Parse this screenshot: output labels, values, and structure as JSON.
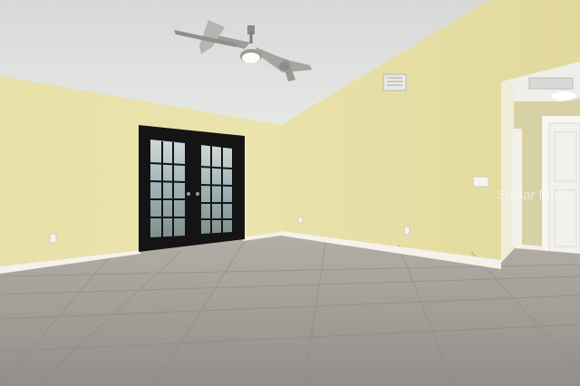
{
  "photo": {
    "subject": "empty-room-interior",
    "watermark_text": "Stellar MLS",
    "palette": {
      "ceiling": "#dcdedd",
      "wall": "#e7dfa7",
      "wall_shadow": "#d9d296",
      "floor": "#a3a09a",
      "door_frame": "#141414",
      "baseboard": "#f4f2ea",
      "hall_door": "#f2f1ee"
    },
    "objects": [
      {
        "name": "ceiling-fan",
        "icon": "ceiling-fan-icon"
      },
      {
        "name": "french-doors",
        "icon": "glass-door-icon"
      },
      {
        "name": "hvac-vent",
        "icon": "vent-icon"
      },
      {
        "name": "light-switch",
        "icon": "switch-icon"
      },
      {
        "name": "hallway-door",
        "icon": "door-icon"
      }
    ]
  }
}
